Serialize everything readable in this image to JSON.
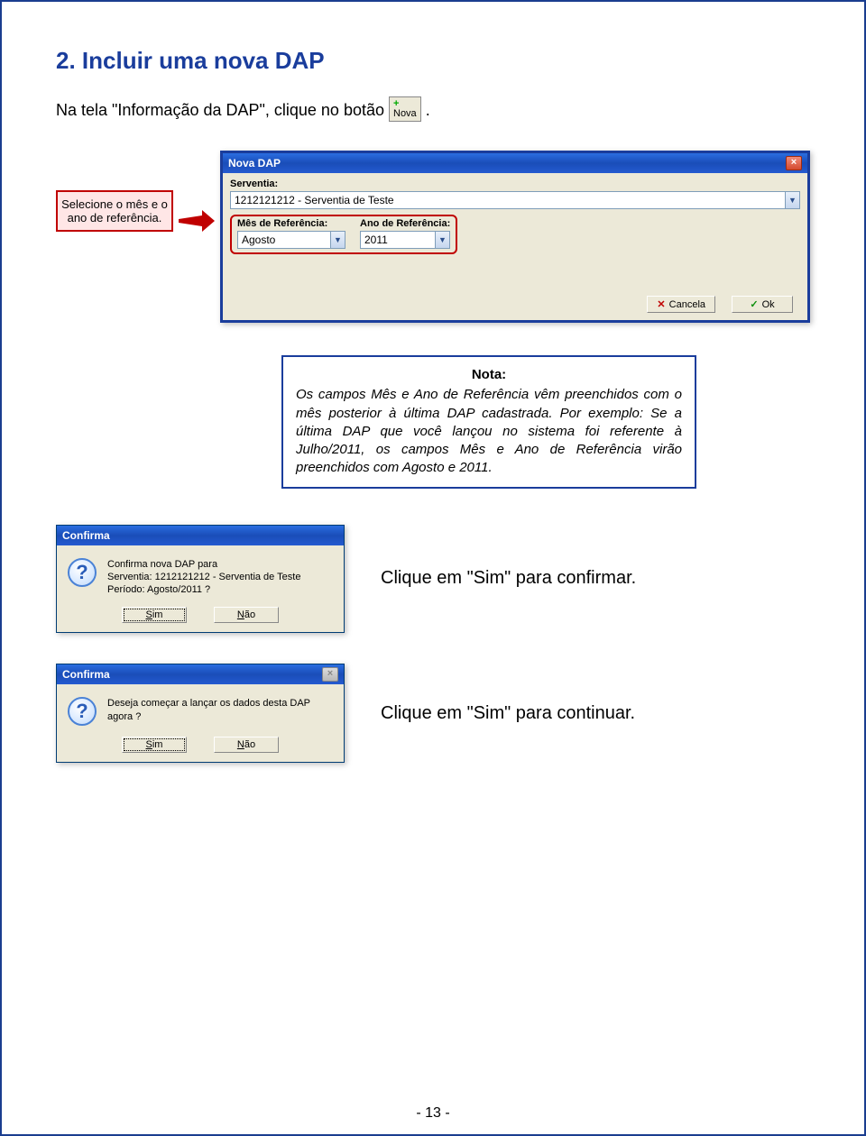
{
  "section_title": "2. Incluir uma nova DAP",
  "intro_prefix": "Na tela \"Informação da DAP\", clique no botão ",
  "intro_suffix": ".",
  "nova_btn": {
    "plus": "+",
    "label": "Nova"
  },
  "callout": "Selecione o mês e o ano de referência.",
  "nova_dap": {
    "title": "Nova DAP",
    "close": "×",
    "serv_label": "Serventia:",
    "serv_value": "1212121212 - Serventia de Teste",
    "mes_label": "Mês de Referência:",
    "mes_value": "Agosto",
    "ano_label": "Ano de Referência:",
    "ano_value": "2011",
    "cancel": "Cancela",
    "ok": "Ok"
  },
  "note": {
    "title": "Nota:",
    "body": "Os campos Mês e Ano de Referência vêm preenchidos com o mês posterior à última DAP cadastrada. Por exemplo: Se a última DAP que você lançou no sistema foi referente à Julho/2011, os campos Mês e Ano de Referência virão preenchidos com Agosto e 2011."
  },
  "confirm1": {
    "title": "Confirma",
    "line1": "Confirma nova DAP para",
    "line2": "Serventia: 1212121212 - Serventia de Teste",
    "line3": "Período: Agosto/2011 ?",
    "sim": "Sim",
    "nao": "Não",
    "instr": "Clique em \"Sim\" para confirmar."
  },
  "confirm2": {
    "title": "Confirma",
    "line1": "Deseja começar a lançar os dados desta DAP agora ?",
    "sim": "Sim",
    "nao": "Não",
    "instr": "Clique em \"Sim\" para continuar."
  },
  "page_num": "- 13 -"
}
